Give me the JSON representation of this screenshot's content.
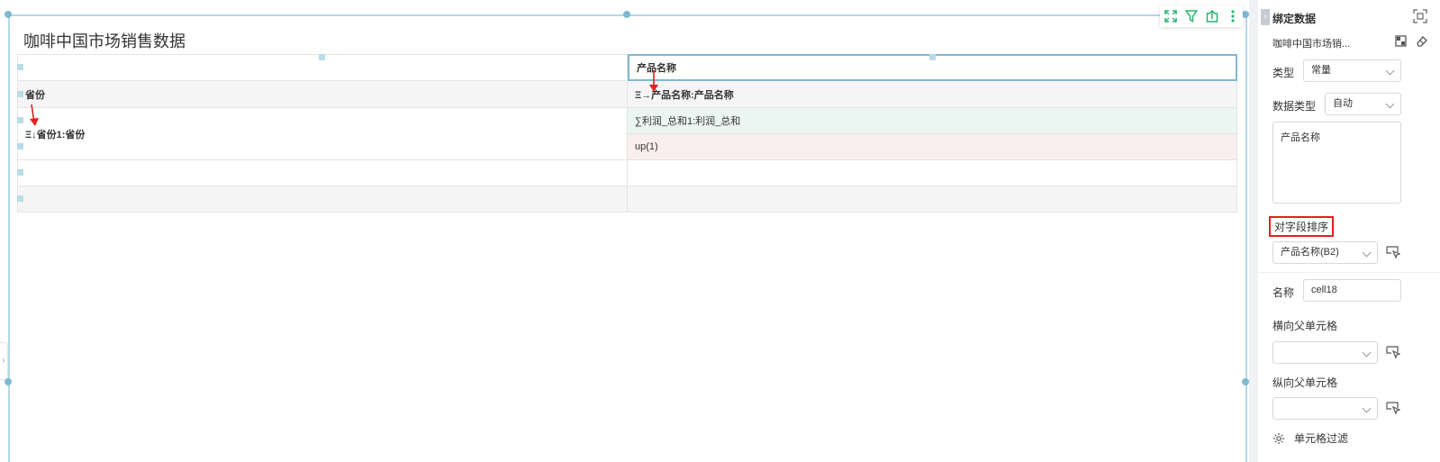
{
  "canvas": {
    "report_title": "咖啡中国市场销售数据",
    "toolbar_icons": [
      "fullscreen-icon",
      "filter-icon",
      "export-icon",
      "more-icon"
    ],
    "grid": {
      "row1": {
        "c1": "",
        "c2": "产品名称"
      },
      "row2": {
        "c1": "省份",
        "c2": "Ξ→产品名称:产品名称"
      },
      "row3": {
        "c1": "Ξ↓省份1:省份",
        "c2a": "∑利润_总和1:利润_总和",
        "c2b": "up(1)"
      },
      "row4": {
        "c1": "",
        "c2": ""
      },
      "row5": {
        "c1": "",
        "c2": ""
      }
    }
  },
  "panel": {
    "title": "绑定数据",
    "source_name": "咖啡中国市场销...",
    "type_label": "类型",
    "type_value": "常量",
    "datatype_label": "数据类型",
    "datatype_value": "自动",
    "content_value": "产品名称",
    "sort_label": "对字段排序",
    "sort_value": "产品名称(B2)",
    "name_label": "名称",
    "name_value": "cell18",
    "h_parent_label": "横向父单元格",
    "h_parent_value": "",
    "v_parent_label": "纵向父单元格",
    "v_parent_value": "",
    "cell_filter_label": "单元格过滤"
  },
  "colors": {
    "accent": "#2bb673",
    "selection": "#7fb9d0",
    "highlight_border": "#e02020",
    "arrow": "#e02020"
  }
}
